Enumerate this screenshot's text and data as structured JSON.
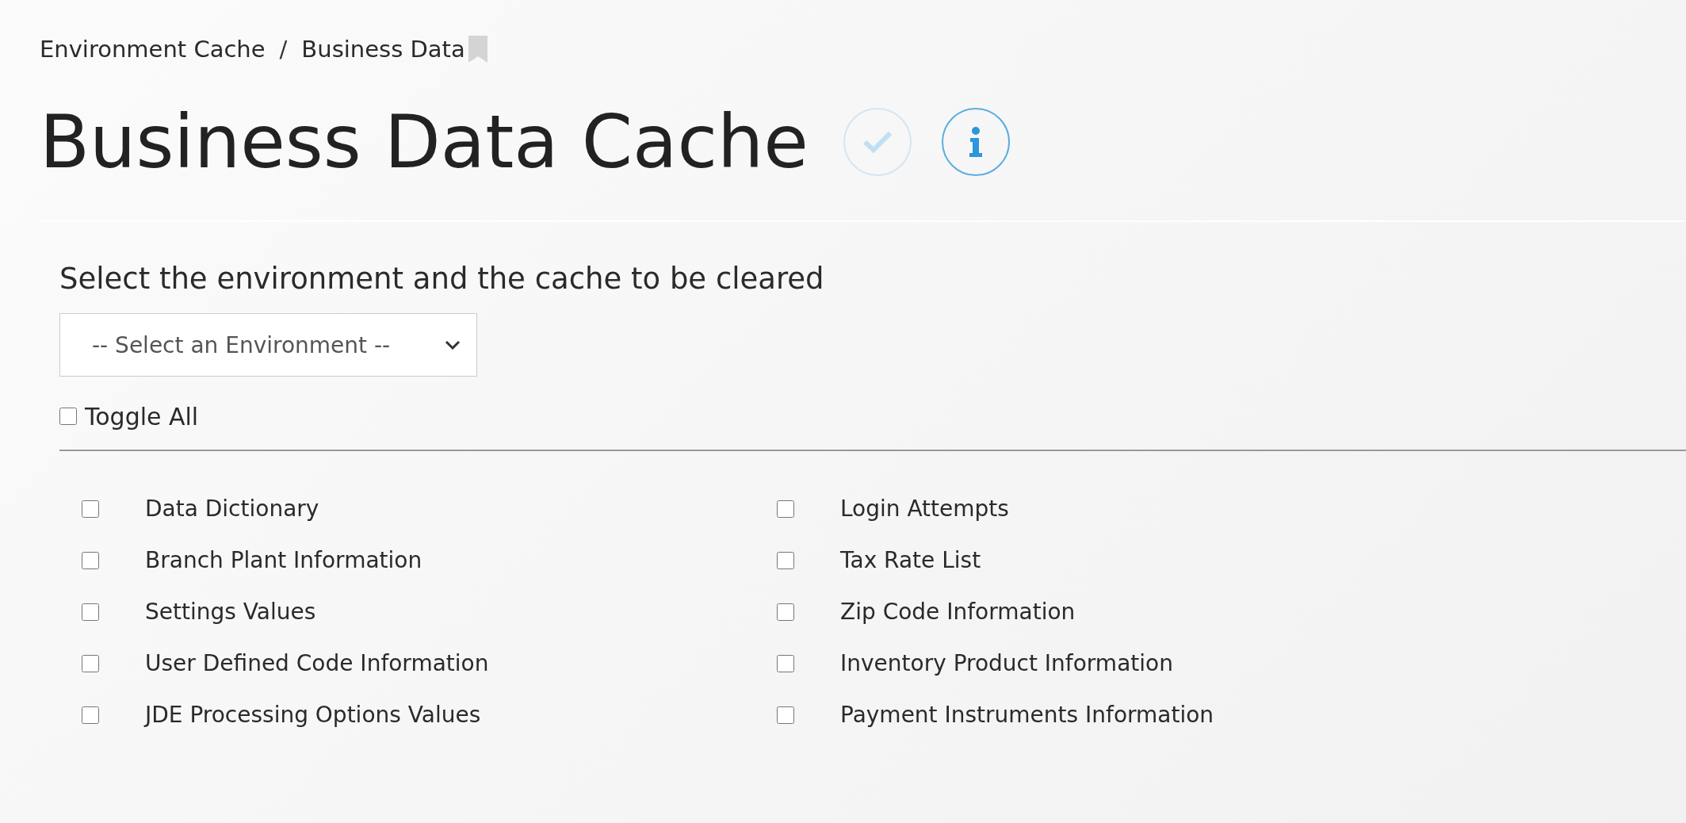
{
  "breadcrumb": [
    {
      "label": "Environment Cache"
    },
    {
      "separator": "/"
    },
    {
      "label": "Business Data"
    }
  ],
  "page_title": "Business Data Cache",
  "header_buttons": [
    {
      "kind": "check",
      "disabled": true
    },
    {
      "kind": "info",
      "disabled": false
    }
  ],
  "instruction": "Select the environment and the cache to be cleared",
  "environment_select": {
    "placeholder": "-- Select an Environment --"
  },
  "toggle_all": {
    "label": "Toggle All",
    "checked": false
  },
  "cache_columns": [
    [
      {
        "label": "Data Dictionary",
        "checked": false
      },
      {
        "label": "Branch Plant Information",
        "checked": false
      },
      {
        "label": "Settings Values",
        "checked": false
      },
      {
        "label": "User Defined Code Information",
        "checked": false
      },
      {
        "label": "JDE Processing Options Values",
        "checked": false
      }
    ],
    [
      {
        "label": "Login Attempts",
        "checked": false
      },
      {
        "label": "Tax Rate List",
        "checked": false
      },
      {
        "label": "Zip Code Information",
        "checked": false
      },
      {
        "label": "Inventory Product Information",
        "checked": false
      },
      {
        "label": "Payment Instruments Information",
        "checked": false
      }
    ]
  ]
}
